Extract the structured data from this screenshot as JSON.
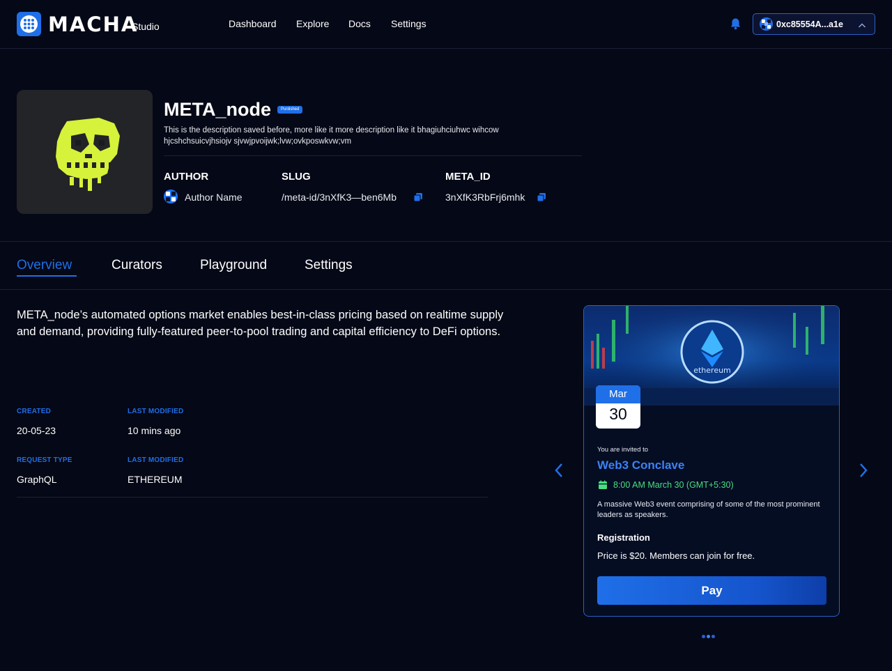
{
  "header": {
    "brand": "MACHA",
    "brand_sub": "Studio",
    "nav": [
      "Dashboard",
      "Explore",
      "Docs",
      "Settings"
    ],
    "wallet_address": "0xc85554A...a1e"
  },
  "profile": {
    "title": "META_node",
    "badge": "Punlished",
    "description": "This is the description saved before, more like it  more description like it bhagiuhciuhwc wihcow hjcshchsuicvjhsiojv sjvwjpvoijwk;lvw;ovkposwkvw;vm",
    "author_label": "AUTHOR",
    "author_value": "Author Name",
    "slug_label": "SLUG",
    "slug_value": "/meta-id/3nXfK3—ben6Mb",
    "metaid_label": "META_ID",
    "metaid_value": "3nXfK3RbFrj6mhk"
  },
  "tabs": [
    {
      "label": "Overview",
      "active": true
    },
    {
      "label": "Curators",
      "active": false
    },
    {
      "label": "Playground",
      "active": false
    },
    {
      "label": "Settings",
      "active": false
    }
  ],
  "overview": {
    "text": "META_node’s automated options market enables best-in-class pricing based on realtime supply and demand, providing fully-featured peer-to-pool trading and capital efficiency to DeFi options.",
    "created_label": "CREATED",
    "created_value": "20-05-23",
    "last_modified_label": "LAST MODIFIED",
    "last_modified_value": "10 mins ago",
    "request_type_label": "REQUEST TYPE",
    "request_type_value": "GraphQL",
    "last_modified2_label": "LAST MODIFIED",
    "last_modified2_value": "ETHEREUM"
  },
  "event_card": {
    "banner_text": "ethereum",
    "month": "Mar",
    "day": "30",
    "invite": "You are invited to",
    "title": "Web3 Conclave",
    "time": "8:00 AM March 30 (GMT+5:30)",
    "description": "A massive Web3 event comprising of some of the most prominent leaders as speakers.",
    "registration_label": "Registration",
    "price_text": "Price is $20.  Members can join for free.",
    "pay_label": "Pay"
  },
  "carousel": {
    "count": 3,
    "active_index": 1
  },
  "colors": {
    "accent": "#1f6fe8",
    "background": "#050816",
    "success": "#4ade80"
  }
}
